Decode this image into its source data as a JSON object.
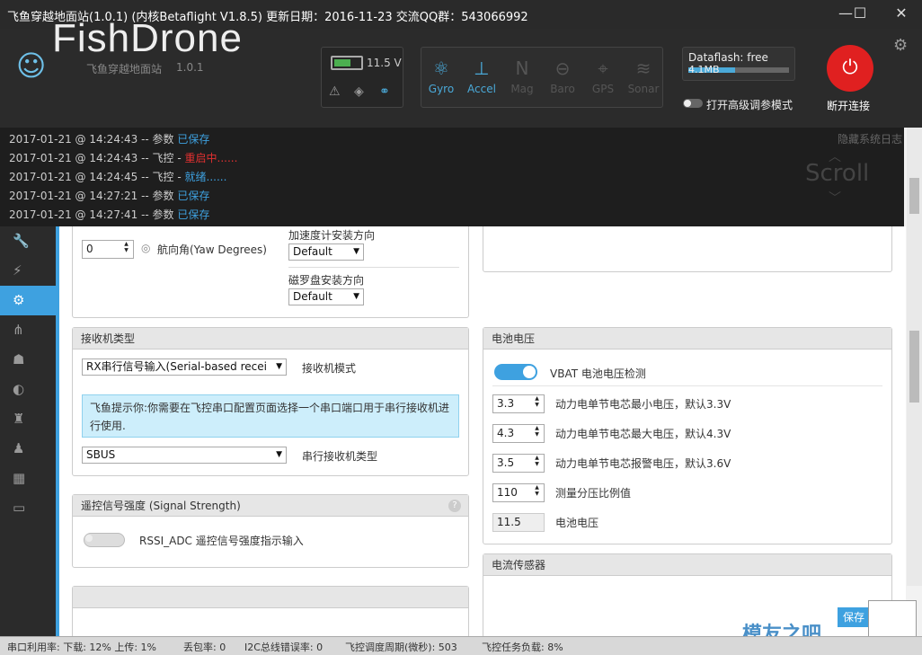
{
  "window": {
    "title": "飞鱼穿越地面站(1.0.1)  (内核Betaflight V1.8.5)  更新日期：2016-11-23  交流QQ群：543066992"
  },
  "header": {
    "logo": "FishDrone",
    "subtitle": "飞鱼穿越地面站",
    "version": "1.0.1",
    "battery_voltage": "11.5 V",
    "battery_level": 0.6,
    "sensors": [
      {
        "label": "Gyro",
        "icon": "gyro-icon",
        "active": true
      },
      {
        "label": "Accel",
        "icon": "accel-icon",
        "active": true
      },
      {
        "label": "Mag",
        "icon": "mag-icon",
        "active": false
      },
      {
        "label": "Baro",
        "icon": "baro-icon",
        "active": false
      },
      {
        "label": "GPS",
        "icon": "gps-icon",
        "active": false
      },
      {
        "label": "Sonar",
        "icon": "sonar-icon",
        "active": false
      }
    ],
    "dataflash_label": "Dataflash: free",
    "dataflash_size": "4.1MB",
    "advanced_mode": "打开高级调参模式",
    "disconnect": "断开连接"
  },
  "log": {
    "hide": "隐藏系统日志",
    "scroll": "Scroll",
    "entries": [
      {
        "time": "2017-01-21 @ 14:24:43",
        "text": " -- 参数 ",
        "status": "已保存",
        "style": "hl"
      },
      {
        "time": "2017-01-21 @ 14:24:43",
        "text": " -- 飞控 - ",
        "status": "重启中......",
        "style": "red"
      },
      {
        "time": "2017-01-21 @ 14:24:45",
        "text": " -- 飞控 - ",
        "status": "就绪......",
        "style": "hl"
      },
      {
        "time": "2017-01-21 @ 14:27:21",
        "text": " -- 参数 ",
        "status": "已保存",
        "style": "hl"
      },
      {
        "time": "2017-01-21 @ 14:27:41",
        "text": " -- 参数 ",
        "status": "已保存",
        "style": "hl"
      }
    ]
  },
  "board": {
    "yaw_value": "0",
    "yaw_label": "航向角(Yaw Degrees)",
    "acc_align_label": "加速度计安装方向",
    "acc_align_value": "Default",
    "mag_align_label": "磁罗盘安装方向",
    "mag_align_value": "Default"
  },
  "receiver": {
    "title": "接收机类型",
    "mode_value": "RX串行信号输入(Serial-based recei",
    "mode_label": "接收机模式",
    "note": "飞鱼提示你:你需要在飞控串口配置页面选择一个串口端口用于串行接收机进行使用.",
    "serial_value": "SBUS",
    "serial_label": "串行接收机类型"
  },
  "rssi": {
    "title": "遥控信号强度 (Signal Strength)",
    "toggle_label": "RSSI_ADC  遥控信号强度指示输入"
  },
  "battery": {
    "title": "电池电压",
    "vbat_label": "VBAT  电池电压检测",
    "min_cell_value": "3.3",
    "min_cell_label": "动力电单节电芯最小电压，默认3.3V",
    "max_cell_value": "4.3",
    "max_cell_label": "动力电单节电芯最大电压，默认4.3V",
    "warn_cell_value": "3.5",
    "warn_cell_label": "动力电单节电芯报警电压，默认3.6V",
    "scale_value": "110",
    "scale_label": "测量分压比例值",
    "voltage_value": "11.5",
    "voltage_label": "电池电压"
  },
  "current": {
    "title": "电流传感器"
  },
  "footer": {
    "save": "保存",
    "watermark": "模友之吧",
    "port_util": "串口利用率: 下载: 12% 上传: 1%",
    "packet_loss": "丢包率: 0",
    "i2c": "I2C总线错误率: 0",
    "cycle": "飞控调度周期(微秒): 503",
    "load": "飞控任务负载: 8%"
  },
  "colors": {
    "accent": "#3ea1e0",
    "danger": "#e02020"
  }
}
